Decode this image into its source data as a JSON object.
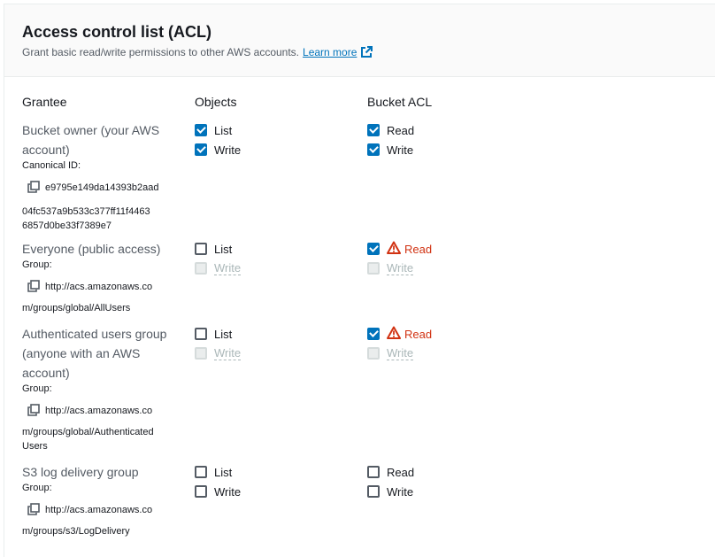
{
  "header": {
    "title": "Access control list (ACL)",
    "description": "Grant basic read/write permissions to other AWS accounts.",
    "learn_more": "Learn more"
  },
  "columns": {
    "grantee": "Grantee",
    "objects": "Objects",
    "bucket_acl": "Bucket ACL"
  },
  "rows": {
    "owner": {
      "name_line1": "Bucket owner (your AWS",
      "name_line2": "account)",
      "id_label": "Canonical ID:",
      "id_line1": "e9795e149da14393b2aad",
      "id_line2": "04fc537a9b533c377ff11f4463",
      "id_line3": "6857d0be33f7389e7",
      "objects_list": "List",
      "objects_write": "Write",
      "acl_read": "Read",
      "acl_write": "Write",
      "objects_list_checked": true,
      "objects_write_checked": true,
      "acl_read_checked": true,
      "acl_write_checked": true
    },
    "everyone": {
      "name": "Everyone (public access)",
      "group_label": "Group:",
      "uri_line1": "http://acs.amazonaws.co",
      "uri_line2": "m/groups/global/AllUsers",
      "objects_list": "List",
      "objects_write": "Write",
      "acl_read": "Read",
      "acl_write": "Write",
      "objects_list_checked": false,
      "objects_write_disabled": true,
      "acl_read_checked": true,
      "acl_read_warning": true,
      "acl_write_disabled": true
    },
    "authenticated": {
      "name_line1": "Authenticated users group",
      "name_line2": "(anyone with an AWS",
      "name_line3": "account)",
      "group_label": "Group:",
      "uri_line1": "http://acs.amazonaws.co",
      "uri_line2": "m/groups/global/Authenticated",
      "uri_line3": "Users",
      "objects_list": "List",
      "objects_write": "Write",
      "acl_read": "Read",
      "acl_write": "Write",
      "objects_list_checked": false,
      "objects_write_disabled": true,
      "acl_read_checked": true,
      "acl_read_warning": true,
      "acl_write_disabled": true
    },
    "logdelivery": {
      "name": "S3 log delivery group",
      "group_label": "Group:",
      "uri_line1": "http://acs.amazonaws.co",
      "uri_line2": "m/groups/s3/LogDelivery",
      "objects_list": "List",
      "objects_write": "Write",
      "acl_read": "Read",
      "acl_write": "Write",
      "objects_list_checked": false,
      "objects_write_checked": false,
      "acl_read_checked": false,
      "acl_write_checked": false
    }
  },
  "colors": {
    "checked": "#0073bb",
    "warning": "#d13212",
    "link": "#0073bb"
  }
}
